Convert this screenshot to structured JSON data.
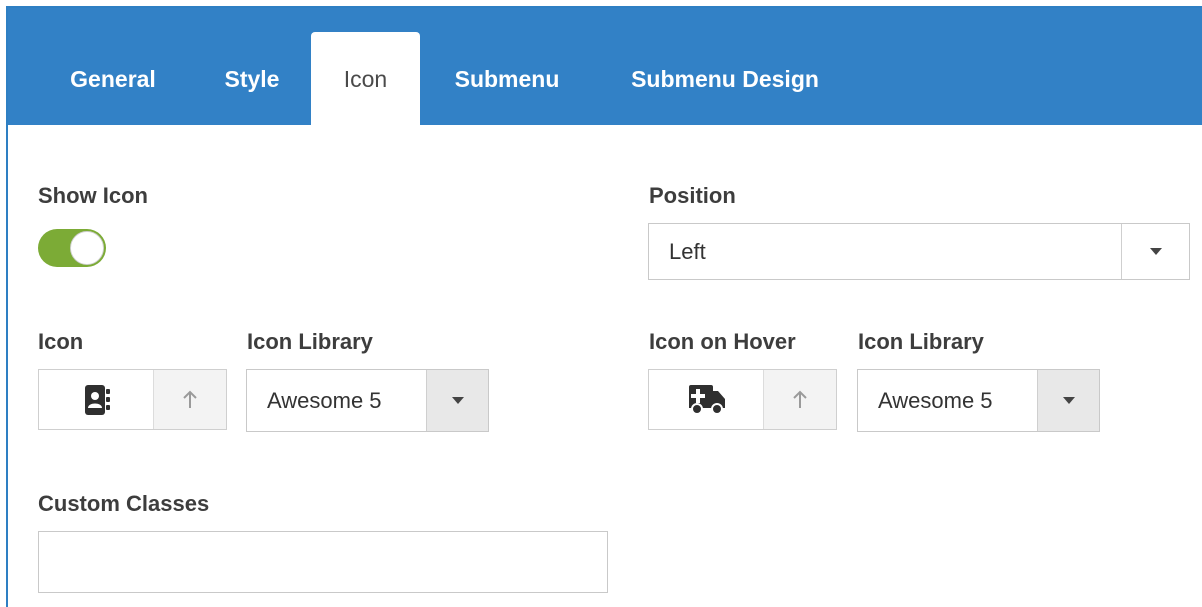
{
  "tabs": [
    {
      "label": "General",
      "active": false
    },
    {
      "label": "Style",
      "active": false
    },
    {
      "label": "Icon",
      "active": true
    },
    {
      "label": "Submenu",
      "active": false
    },
    {
      "label": "Submenu Design",
      "active": false
    }
  ],
  "colors": {
    "tabbar": "#3281c6",
    "toggle_on": "#7cab36"
  },
  "show_icon": {
    "label": "Show Icon",
    "enabled": true
  },
  "position": {
    "label": "Position",
    "value": "Left"
  },
  "icon": {
    "label": "Icon",
    "icon_name": "address-book-icon",
    "library_label": "Icon Library",
    "library_value": "Awesome 5"
  },
  "icon_hover": {
    "label": "Icon on Hover",
    "icon_name": "ambulance-icon",
    "library_label": "Icon Library",
    "library_value": "Awesome 5"
  },
  "custom_classes": {
    "label": "Custom Classes",
    "value": ""
  }
}
